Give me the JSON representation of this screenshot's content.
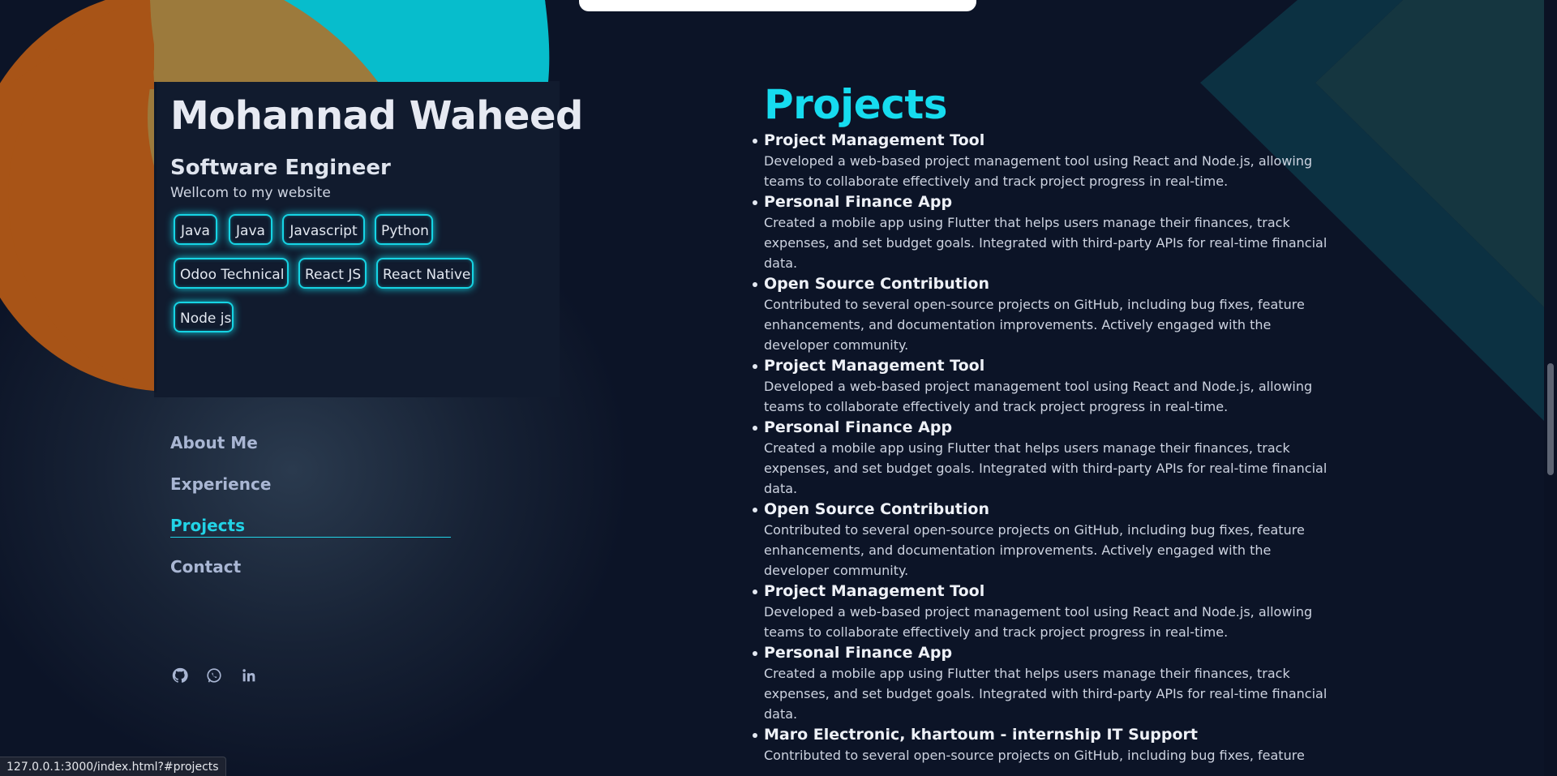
{
  "profile": {
    "name": "Mohannad Waheed",
    "role": "Software Engineer",
    "welcome": "Wellcom to my website"
  },
  "skills": [
    "Java",
    "Java",
    "Javascript",
    "Python",
    "Odoo Technical",
    "React JS",
    "React Native",
    "Node js"
  ],
  "nav": {
    "about": "About Me",
    "experience": "Experience",
    "projects": "Projects",
    "contact": "Contact",
    "active": "Projects"
  },
  "social": [
    "github-icon",
    "whatsapp-icon",
    "linkedin-icon"
  ],
  "projects_section": {
    "title": "Projects",
    "items": [
      {
        "name": "Project Management Tool",
        "desc": "Developed a web-based project management tool using React and Node.js, allowing teams to collaborate effectively and track project progress in real-time."
      },
      {
        "name": "Personal Finance App",
        "desc": "Created a mobile app using Flutter that helps users manage their finances, track expenses, and set budget goals. Integrated with third-party APIs for real-time financial data."
      },
      {
        "name": "Open Source Contribution",
        "desc": "Contributed to several open-source projects on GitHub, including bug fixes, feature enhancements, and documentation improvements. Actively engaged with the developer community."
      },
      {
        "name": "Project Management Tool",
        "desc": "Developed a web-based project management tool using React and Node.js, allowing teams to collaborate effectively and track project progress in real-time."
      },
      {
        "name": "Personal Finance App",
        "desc": "Created a mobile app using Flutter that helps users manage their finances, track expenses, and set budget goals. Integrated with third-party APIs for real-time financial data."
      },
      {
        "name": "Open Source Contribution",
        "desc": "Contributed to several open-source projects on GitHub, including bug fixes, feature enhancements, and documentation improvements. Actively engaged with the developer community."
      },
      {
        "name": "Project Management Tool",
        "desc": "Developed a web-based project management tool using React and Node.js, allowing teams to collaborate effectively and track project progress in real-time."
      },
      {
        "name": "Personal Finance App",
        "desc": "Created a mobile app using Flutter that helps users manage their finances, track expenses, and set budget goals. Integrated with third-party APIs for real-time financial data."
      },
      {
        "name": "Maro Electronic, khartoum - internship IT Support",
        "desc": "Contributed to several open-source projects on GitHub, including bug fixes, feature"
      }
    ]
  },
  "status_url": "127.0.0.1:3000/index.html?#projects",
  "colors": {
    "accent": "#16dcef",
    "background": "#0b1224",
    "orange": "#a85417",
    "cyan": "#07bdcc",
    "tan": "#9c7a3c",
    "nav_text": "#a9b6d3"
  }
}
